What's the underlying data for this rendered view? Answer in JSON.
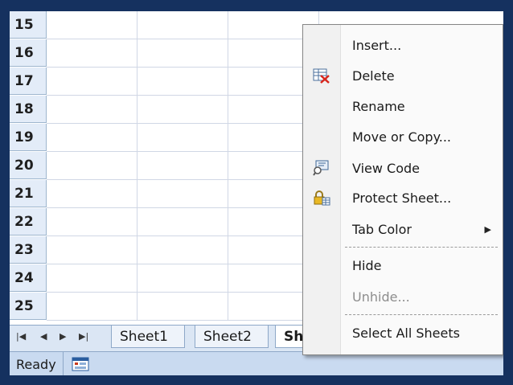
{
  "grid": {
    "rows": [
      "15",
      "16",
      "17",
      "18",
      "19",
      "20",
      "21",
      "22",
      "23",
      "24",
      "25"
    ]
  },
  "tabs": {
    "nav": {
      "first": "|◀",
      "prev": "◀",
      "next": "▶",
      "last": "▶|"
    },
    "sheets": [
      {
        "label": "Sheet1",
        "active": false
      },
      {
        "label": "Sheet2",
        "active": false
      },
      {
        "label": "Sh",
        "active": true
      }
    ]
  },
  "status": {
    "text": "Ready",
    "icon": "macro-record-icon"
  },
  "context_menu": {
    "items": [
      {
        "label": "Insert...",
        "icon": null,
        "disabled": false
      },
      {
        "label": "Delete",
        "icon": "delete-sheet-icon",
        "disabled": false
      },
      {
        "label": "Rename",
        "icon": null,
        "disabled": false
      },
      {
        "label": "Move or Copy...",
        "icon": null,
        "disabled": false
      },
      {
        "label": "View Code",
        "icon": "view-code-icon",
        "disabled": false
      },
      {
        "label": "Protect Sheet...",
        "icon": "protect-sheet-icon",
        "disabled": false
      },
      {
        "label": "Tab Color",
        "icon": null,
        "disabled": false,
        "submenu": true
      },
      {
        "label": "Hide",
        "icon": null,
        "disabled": false
      },
      {
        "label": "Unhide...",
        "icon": null,
        "disabled": true
      },
      {
        "label": "Select All Sheets",
        "icon": null,
        "disabled": false
      }
    ]
  }
}
